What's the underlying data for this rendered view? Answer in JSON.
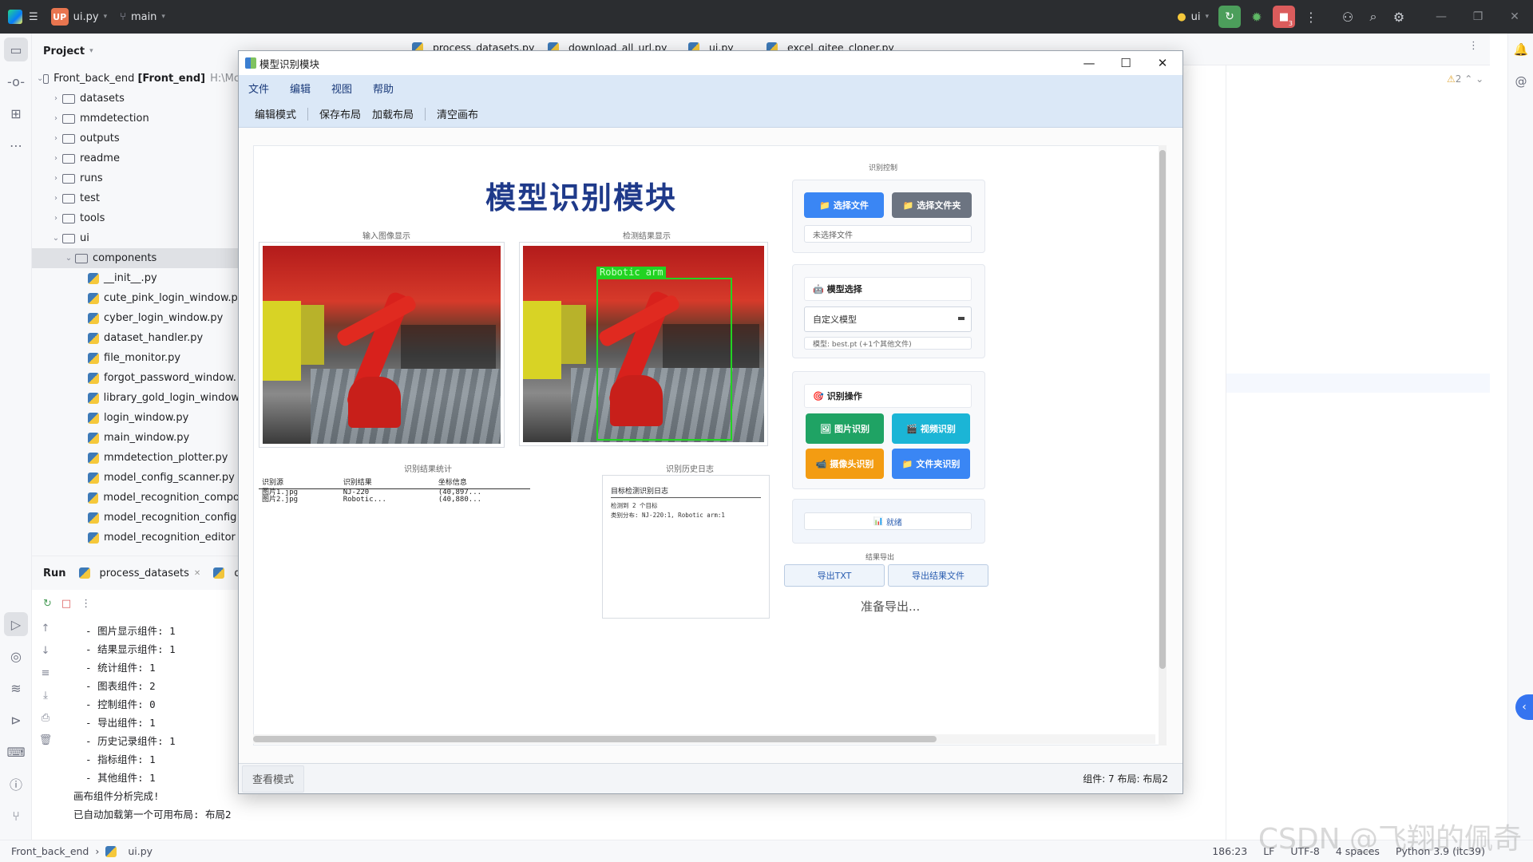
{
  "ide": {
    "project_badge": "UP",
    "file_name": "ui.py",
    "branch": "main",
    "run_config": "ui",
    "run_badge_count": "3"
  },
  "project_panel": {
    "title": "Project",
    "root_name": "Front_back_end",
    "root_module": "[Front_end]",
    "root_path": "H:\\Mc",
    "items": [
      {
        "label": "datasets",
        "type": "folder",
        "level": 1
      },
      {
        "label": "mmdetection",
        "type": "folder",
        "level": 1
      },
      {
        "label": "outputs",
        "type": "folder",
        "level": 1
      },
      {
        "label": "readme",
        "type": "folder",
        "level": 1
      },
      {
        "label": "runs",
        "type": "folder",
        "level": 1
      },
      {
        "label": "test",
        "type": "folder",
        "level": 1
      },
      {
        "label": "tools",
        "type": "folder",
        "level": 1
      },
      {
        "label": "ui",
        "type": "folder",
        "level": 1
      },
      {
        "label": "components",
        "type": "folder",
        "level": 2
      },
      {
        "label": "__init__.py",
        "type": "py",
        "level": 3
      },
      {
        "label": "cute_pink_login_window.p",
        "type": "py",
        "level": 3
      },
      {
        "label": "cyber_login_window.py",
        "type": "py",
        "level": 3
      },
      {
        "label": "dataset_handler.py",
        "type": "py",
        "level": 3
      },
      {
        "label": "file_monitor.py",
        "type": "py",
        "level": 3
      },
      {
        "label": "forgot_password_window.",
        "type": "py",
        "level": 3
      },
      {
        "label": "library_gold_login_window",
        "type": "py",
        "level": 3
      },
      {
        "label": "login_window.py",
        "type": "py",
        "level": 3
      },
      {
        "label": "main_window.py",
        "type": "py",
        "level": 3
      },
      {
        "label": "mmdetection_plotter.py",
        "type": "py",
        "level": 3
      },
      {
        "label": "model_config_scanner.py",
        "type": "py",
        "level": 3
      },
      {
        "label": "model_recognition_compo",
        "type": "py",
        "level": 3
      },
      {
        "label": "model_recognition_config",
        "type": "py",
        "level": 3
      },
      {
        "label": "model_recognition_editor",
        "type": "py",
        "level": 3
      }
    ]
  },
  "run_panel": {
    "title": "Run",
    "tab1": "process_datasets",
    "tab2": "do",
    "console_lines": [
      "  - 图片显示组件: 1",
      "  - 结果显示组件: 1",
      "  - 统计组件: 1",
      "  - 图表组件: 2",
      "  - 控制组件: 0",
      "  - 导出组件: 1",
      "  - 历史记录组件: 1",
      "  - 指标组件: 1",
      "  - 其他组件: 1",
      "画布组件分析完成!",
      "已自动加载第一个可用布局: 布局2"
    ]
  },
  "editor_tabs": [
    "process_datasets.py",
    "download_all_url.py",
    "ui.py",
    "excel_gitee_cloner.py"
  ],
  "editor": {
    "warning_count": "2"
  },
  "statusbar": {
    "project": "Front_back_end",
    "file": "ui.py",
    "position": "186:23",
    "line_sep": "LF",
    "encoding": "UTF-8",
    "indent": "4 spaces",
    "interpreter": "Python 3.9 (itc39)"
  },
  "watermark": "CSDN @飞翔的佩奇",
  "dialog": {
    "title": "模型识别模块",
    "menus": [
      "文件",
      "编辑",
      "视图",
      "帮助"
    ],
    "toolbar": [
      "编辑模式",
      "保存布局",
      "加载布局",
      "清空画布"
    ],
    "canvas": {
      "big_title": "模型识别模块",
      "input_caption": "输入图像显示",
      "result_caption": "检测结果显示",
      "detection_label": "Robotic arm",
      "stats_caption": "识别结果统计",
      "stats_headers": [
        "识别源",
        "识别结果",
        "坐标信息"
      ],
      "stats_rows": [
        [
          "图片1.jpg",
          "NJ-220",
          "(40,897..."
        ],
        [
          "图片2.jpg",
          "Robotic...",
          "(40,880..."
        ]
      ],
      "history_caption": "识别历史日志",
      "history_title": "目标检测识别日志",
      "history_lines": [
        "检测到 2 个目标",
        "类别分布: NJ-220:1, Robotic arm:1"
      ],
      "control_caption": "识别控制",
      "select_file": "选择文件",
      "select_folder": "选择文件夹",
      "file_status": "未选择文件",
      "model_select_head": "模型选择",
      "model_combo": "自定义模型",
      "model_info": "模型: best.pt (+1个其他文件)",
      "recog_head": "识别操作",
      "image_recog": "图片识别",
      "video_recog": "视频识别",
      "camera_recog": "摄像头识别",
      "folder_recog": "文件夹识别",
      "ready": "就绪",
      "export_caption": "结果导出",
      "export_txt": "导出TXT",
      "export_result": "导出结果文件",
      "prep_export": "准备导出..."
    },
    "footer": {
      "mode": "查看模式",
      "status": "组件: 7  布局: 布局2"
    }
  }
}
